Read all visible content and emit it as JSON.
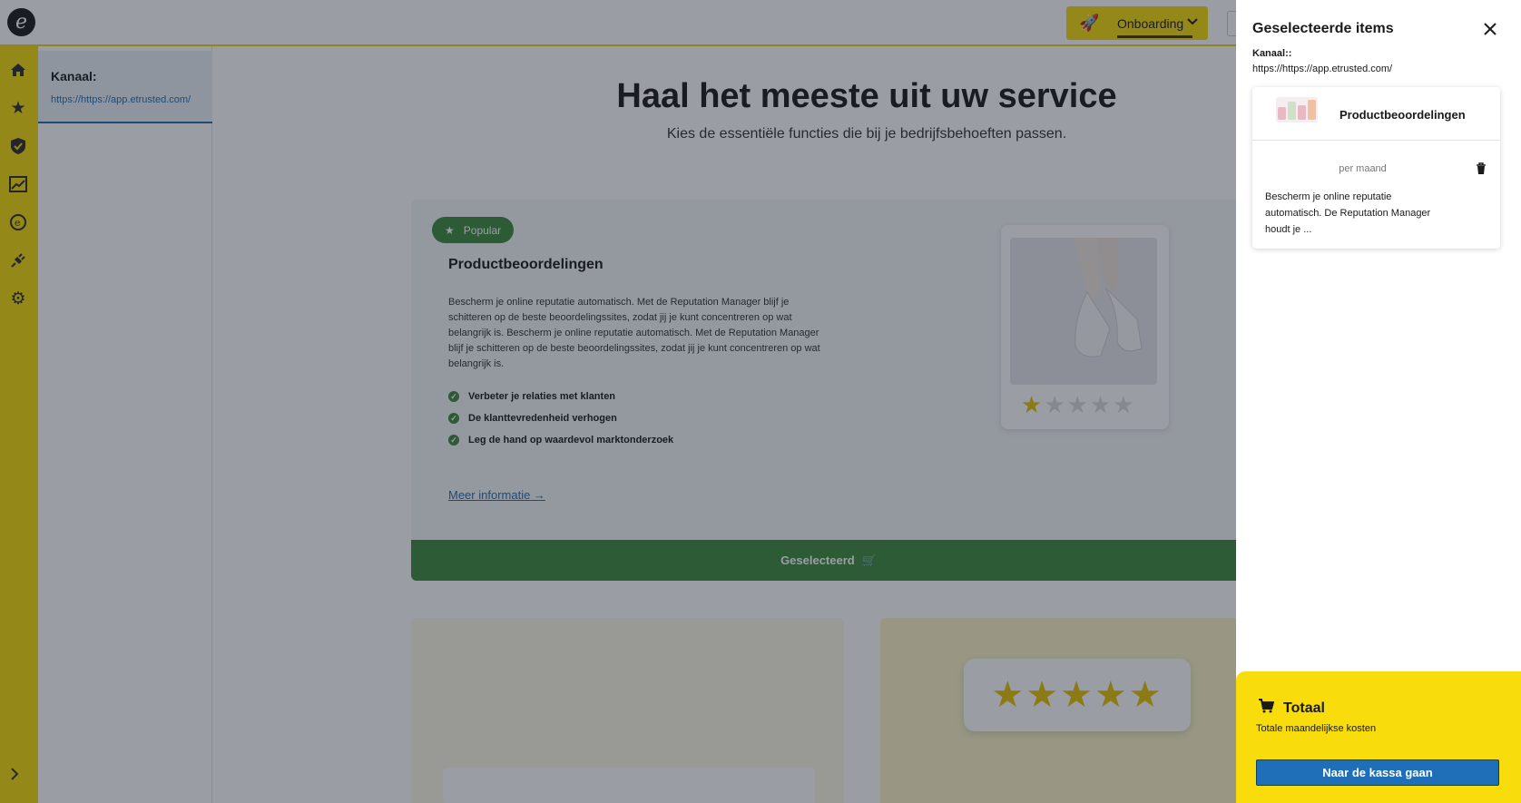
{
  "topbar": {
    "logo_icon": "etrusted-logo-icon",
    "onboarding_label": "Onboarding",
    "onboarding_icon": "rocket-icon",
    "chevron_icon": "chevron-down-icon"
  },
  "nav": {
    "icons": [
      "home-icon",
      "star-icon",
      "shield-check-icon",
      "analytics-icon",
      "etrusted-icon",
      "plug-icon",
      "gear-icon"
    ],
    "expand_icon": "chevron-right-icon"
  },
  "channel_panel": {
    "label": "Kanaal:",
    "url": "https://https://app.etrusted.com/"
  },
  "main": {
    "title": "Haal het meeste uit uw service",
    "subtitle": "Kies de essentiële functies die bij je bedrijfsbehoeften passen.",
    "product": {
      "badge": "Popular",
      "title": "Productbeoordelingen",
      "description": "Bescherm je online reputatie automatisch. Met de Reputation Manager blijf je schitteren op de beste beoordelingssites, zodat jij je kunt concentreren op wat belangrijk is. Bescherm je online reputatie automatisch. Met de Reputation Manager blijf je schitteren op de beste beoordelingssites, zodat jij je kunt concentreren op wat belangrijk is.",
      "benefits": [
        "Verbeter je relaties met klanten",
        "De klanttevredenheid verhogen",
        "Leg de hand op waardevol marktonderzoek"
      ],
      "more_link": "Meer informatie",
      "select_label": "Geselecteerd",
      "rating_stars_filled": 1,
      "rating_stars_total": 5
    }
  },
  "drawer": {
    "title": "Geselecteerde items",
    "channel_label": "Kanaal::",
    "channel_url": "https://https://app.etrusted.com/",
    "item": {
      "name": "Productbeoordelingen",
      "price": "per maand",
      "description": "Bescherm je online reputatie automatisch. De Reputation Manager houdt je ..."
    },
    "total": {
      "title": "Totaal",
      "subtitle": "Totale maandelijkse kosten",
      "checkout_label": "Naar de kassa gaan"
    }
  },
  "colors": {
    "brand_yellow": "#f5d90a",
    "primary_blue": "#1f6fb8",
    "success_green": "#3c8a3e"
  }
}
